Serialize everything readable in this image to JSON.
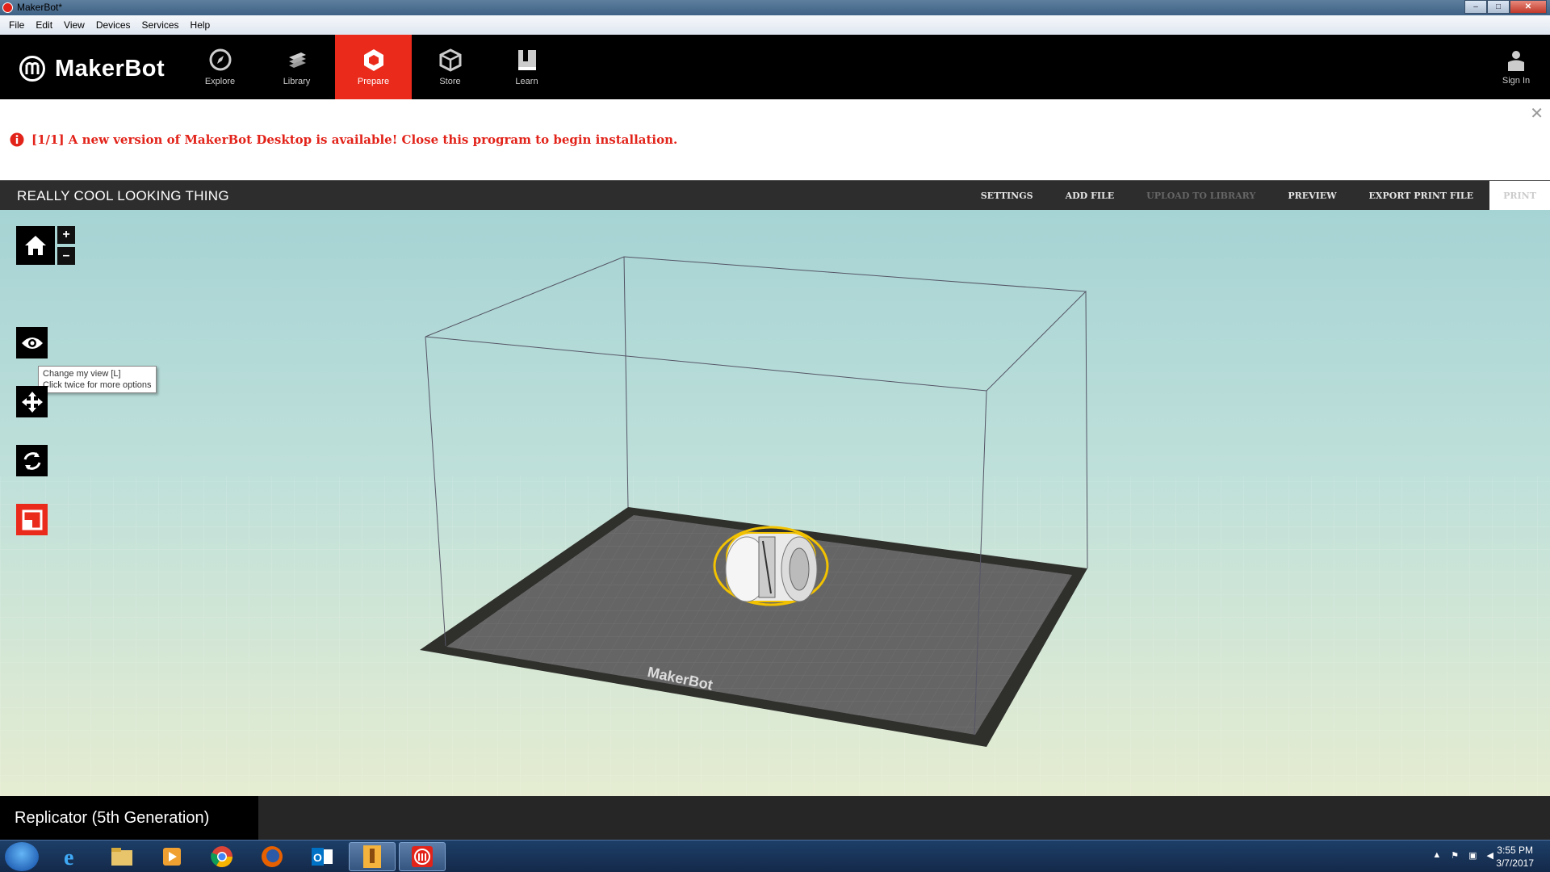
{
  "window": {
    "title": "MakerBot*",
    "buttons": [
      "minimize",
      "maximize",
      "close"
    ]
  },
  "menu": [
    "File",
    "Edit",
    "View",
    "Devices",
    "Services",
    "Help"
  ],
  "header": {
    "logo_text": "MakerBot",
    "nav": [
      {
        "label": "Explore",
        "icon": "compass-icon"
      },
      {
        "label": "Library",
        "icon": "library-icon"
      },
      {
        "label": "Prepare",
        "icon": "prepare-icon",
        "active": true
      },
      {
        "label": "Store",
        "icon": "store-box-icon"
      },
      {
        "label": "Learn",
        "icon": "learn-book-icon"
      }
    ],
    "sign_in": "Sign In",
    "accent": "#ea2a1b"
  },
  "notification": {
    "message": "[1/1] A new version of MakerBot Desktop is available! Close this program to begin installation.",
    "color": "#e2231a"
  },
  "project": {
    "title": "REALLY COOL LOOKING THING",
    "actions": [
      {
        "label": "SETTINGS",
        "enabled": true
      },
      {
        "label": "ADD FILE",
        "enabled": true
      },
      {
        "label": "UPLOAD TO LIBRARY",
        "enabled": false
      },
      {
        "label": "PREVIEW",
        "enabled": true
      },
      {
        "label": "EXPORT PRINT FILE",
        "enabled": true
      },
      {
        "label": "PRINT",
        "enabled": false
      }
    ]
  },
  "viewport": {
    "tooltip_line1": "Change my view [L]",
    "tooltip_line2": "Click twice for more options",
    "zoom_in": "+",
    "zoom_out": "–",
    "plate_logo": "MakerBot"
  },
  "status": {
    "printer": "Replicator (5th Generation)"
  },
  "taskbar": {
    "time": "3:55 PM",
    "date": "3/7/2017",
    "apps": [
      "ie-icon",
      "file-explorer-icon",
      "media-player-icon",
      "chrome-icon",
      "firefox-icon",
      "outlook-icon",
      "inventor-icon",
      "makerbot-icon"
    ]
  }
}
